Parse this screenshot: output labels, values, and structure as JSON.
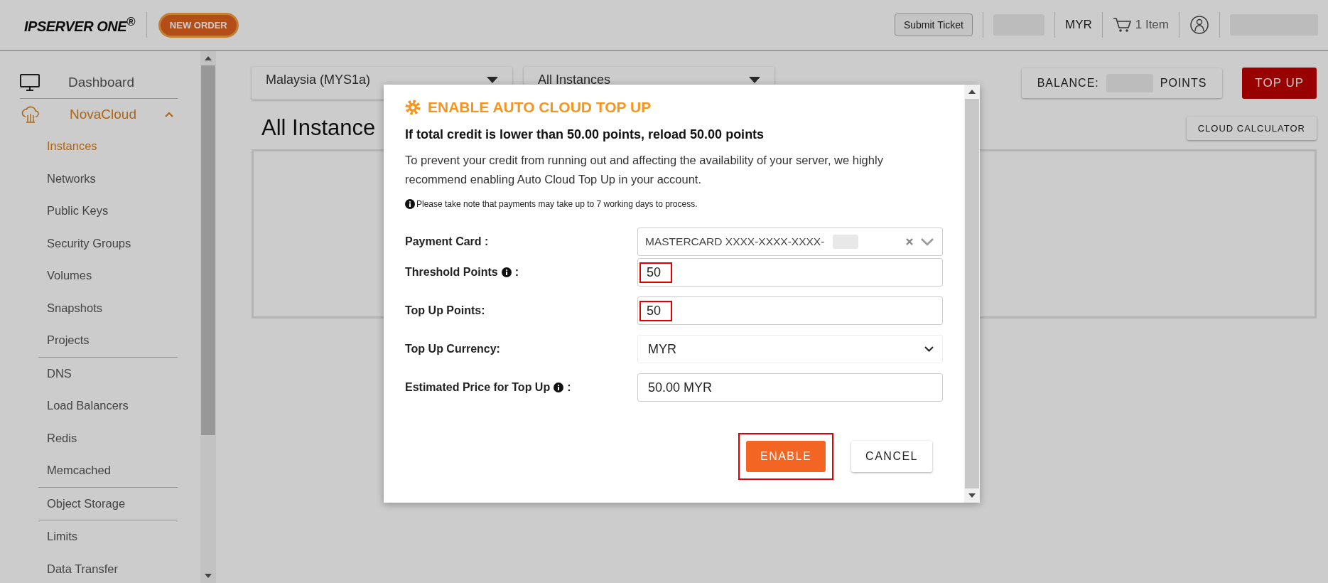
{
  "header": {
    "logo": "IPSERVER ONE$^{®}$",
    "new_order": "NEW ORDER",
    "submit_ticket": "Submit Ticket",
    "currency": "MYR",
    "cart": "1 Item"
  },
  "sidebar": {
    "items": [
      {
        "label": "Dashboard",
        "selected": false
      },
      {
        "label": "NovaCloud",
        "selected": true,
        "expanded": true,
        "children": [
          {
            "label": "Instances",
            "selected": true,
            "separator_before": false
          },
          {
            "label": "Networks",
            "selected": false,
            "separator_before": false
          },
          {
            "label": "Public Keys",
            "selected": false,
            "separator_before": false
          },
          {
            "label": "Security Groups",
            "selected": false,
            "separator_before": false
          },
          {
            "label": "Volumes",
            "selected": false,
            "separator_before": false
          },
          {
            "label": "Snapshots",
            "selected": false,
            "separator_before": false
          },
          {
            "label": "Projects",
            "selected": false,
            "separator_before": false
          },
          {
            "label": "DNS",
            "selected": false,
            "separator_before": true
          },
          {
            "label": "Load Balancers",
            "selected": false,
            "separator_before": false
          },
          {
            "label": "Redis",
            "selected": false,
            "separator_before": false
          },
          {
            "label": "Memcached",
            "selected": false,
            "separator_before": false
          },
          {
            "label": "Object Storage",
            "selected": false,
            "separator_before": true
          },
          {
            "label": "Limits",
            "selected": false,
            "separator_before": true
          },
          {
            "label": "Data Transfer",
            "selected": false,
            "separator_before": false
          }
        ]
      }
    ]
  },
  "toolbar": {
    "region": "Malaysia (MYS1a)",
    "filter": "All Instances",
    "balance_label": "BALANCE:",
    "balance_unit": "POINTS",
    "top_up": "TOP UP",
    "heading": "All Instance",
    "cloud_calculator": "CLOUD CALCULATOR"
  },
  "modal": {
    "title": "ENABLE AUTO CLOUD TOP UP",
    "headline": "If total credit is lower than 50.00 points, reload 50.00 points",
    "description": "To prevent your credit from running out and affecting the availability of your server, we highly recommend enabling Auto Cloud Top Up in your account.",
    "note": "Please take note that payments may take up to 7 working days to process.",
    "fields": [
      {
        "kind": "card-select",
        "label": "Payment Card :",
        "info": false,
        "value": "MASTERCARD XXXX-XXXX-XXXX-",
        "highlighted": false
      },
      {
        "kind": "input",
        "label": "Threshold Points",
        "info": true,
        "label_end": ":",
        "value": "50",
        "highlighted": true
      },
      {
        "kind": "input",
        "label": "Top Up Points:",
        "info": false,
        "value": "50",
        "highlighted": true
      },
      {
        "kind": "select",
        "label": "Top Up Currency:",
        "info": false,
        "value": "MYR",
        "highlighted": false
      },
      {
        "kind": "input",
        "label": "Estimated Price for Top Up",
        "info": true,
        "label_end": ":",
        "value": "50.00 MYR",
        "highlighted": false
      }
    ],
    "buttons": [
      {
        "label": "ENABLE",
        "kind": "primary",
        "highlighted": true
      },
      {
        "label": "CANCEL",
        "kind": "secondary",
        "highlighted": false
      }
    ]
  }
}
